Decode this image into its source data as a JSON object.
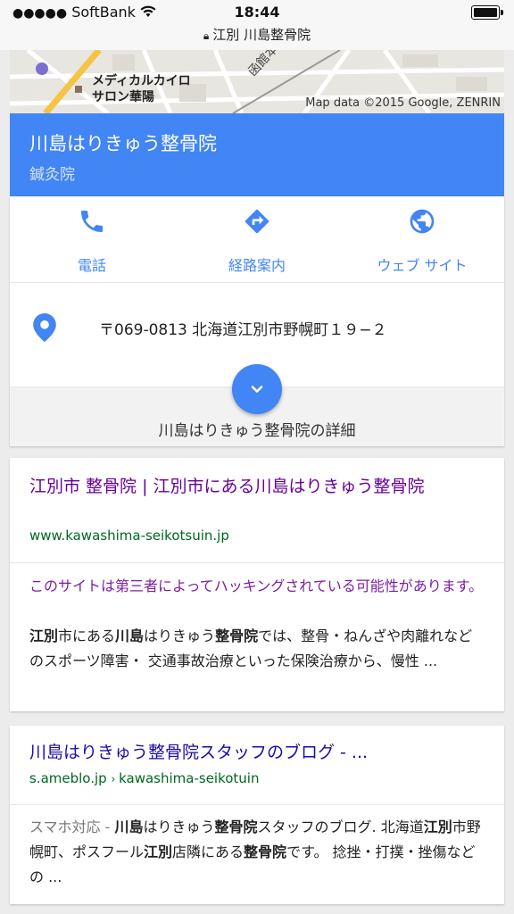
{
  "status": {
    "carrier": "SoftBank",
    "signal_dots": "●●●●●",
    "time": "18:44",
    "url": "江別 川島整骨院"
  },
  "map": {
    "place_label_1": "メディカルカイロ",
    "place_label_2": "サロン華陽",
    "street_label": "函館本線",
    "copyright": "Map data ©2015 Google, ZENRIN"
  },
  "knowledge_panel": {
    "title": "川島はりきゅう整骨院",
    "subtitle": "鍼灸院",
    "actions": [
      {
        "label": "電話",
        "icon": "phone-icon"
      },
      {
        "label": "経路案内",
        "icon": "directions-icon"
      },
      {
        "label": "ウェブ サイト",
        "icon": "globe-icon"
      }
    ],
    "address": "〒069-0813 北海道江別市野幌町１９−２",
    "details_label": "川島はりきゅう整骨院の詳細"
  },
  "results": [
    {
      "title": "江別市 整骨院 | 江別市にある川島はりきゅう整骨院",
      "url": "www.kawashima-seikotsuin.jp",
      "warning": "このサイトは第三者によってハッキングされている可能性があります。",
      "snippet_parts": [
        "江別",
        "市にある",
        "川島",
        "はりきゅう",
        "整骨院",
        "では、整骨・ねんざや肉離れなどのスポーツ障害・ 交通事故治療といった保険治療から、慢性 ..."
      ]
    },
    {
      "title": "川島はりきゅう整骨院スタッフのブログ - ...",
      "url_domain": "s.ameblo.jp",
      "url_path": "kawashima-seikotuin",
      "snippet_prefix": "スマホ対応 - ",
      "snippet_parts": [
        "川島",
        "はりきゅう",
        "整骨院",
        "スタッフのブログ. 北海道",
        "江別",
        "市野幌町、ポスフール",
        "江別",
        "店隣にある",
        "整骨院",
        "です。 捻挫・打撲・挫傷などの ..."
      ]
    }
  ],
  "colors": {
    "accent": "#4285f4",
    "visited_link": "#660099",
    "link": "#1a0dab",
    "url_green": "#006621",
    "warning": "#7b1fa2"
  }
}
